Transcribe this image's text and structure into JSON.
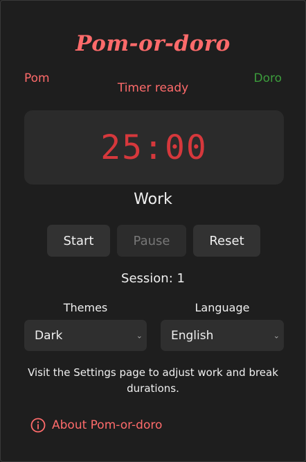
{
  "app": {
    "title": "Pom-or-doro",
    "left_label": "Pom",
    "right_label": "Doro",
    "status": "Timer ready"
  },
  "timer": {
    "display": "25:00",
    "mode": "Work"
  },
  "controls": {
    "start_label": "Start",
    "pause_label": "Pause",
    "reset_label": "Reset"
  },
  "session": {
    "text": "Session: 1"
  },
  "settings": {
    "themes_label": "Themes",
    "theme_value": "Dark",
    "language_label": "Language",
    "language_value": "English"
  },
  "hint": "Visit the Settings page to adjust work and break durations.",
  "about": {
    "label": "About Pom-or-doro",
    "icon": "info-icon"
  },
  "colors": {
    "background": "#1e1e1e",
    "accent": "#ff6b6b",
    "timer": "#d6383c",
    "doro": "#3c9d3c",
    "surface": "#2b2b2b"
  }
}
